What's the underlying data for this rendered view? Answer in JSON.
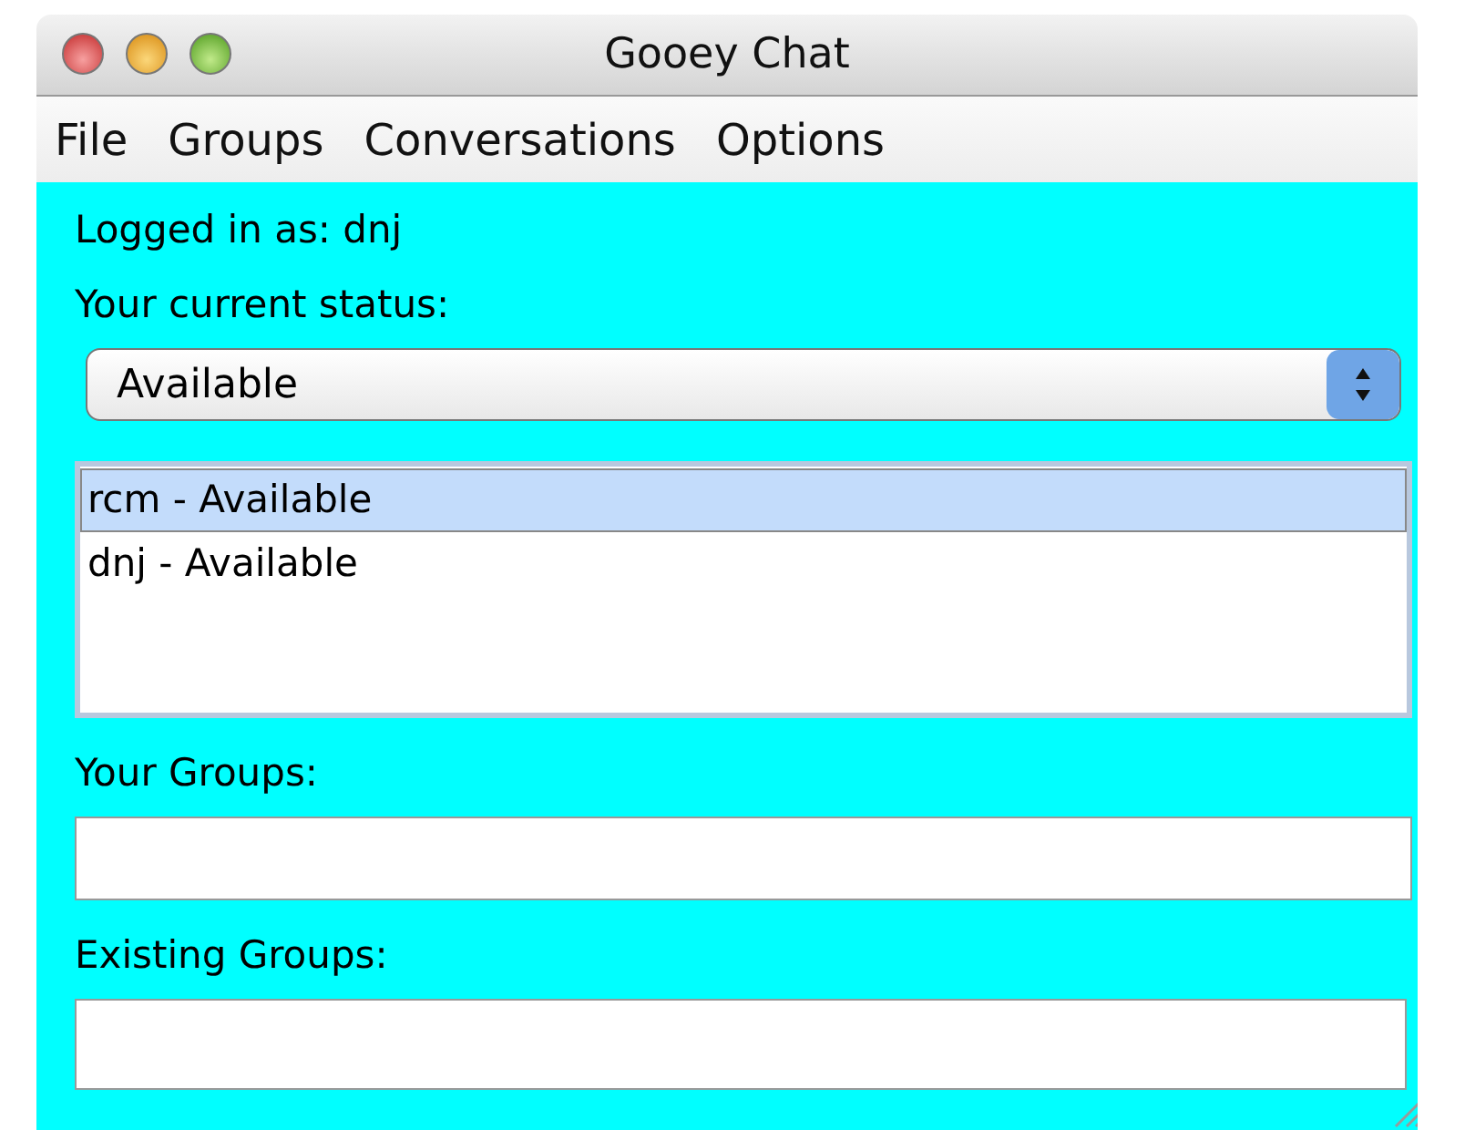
{
  "window": {
    "title": "Gooey Chat"
  },
  "menu": [
    "File",
    "Groups",
    "Conversations",
    "Options"
  ],
  "login_label": "Logged in as: dnj",
  "status_label": "Your current status:",
  "status_select": {
    "value": "Available"
  },
  "users": [
    {
      "label": "rcm - Available",
      "selected": true
    },
    {
      "label": "dnj - Available",
      "selected": false
    }
  ],
  "your_groups": {
    "label": "Your Groups:"
  },
  "existing_groups": {
    "label": "Existing Groups:"
  }
}
